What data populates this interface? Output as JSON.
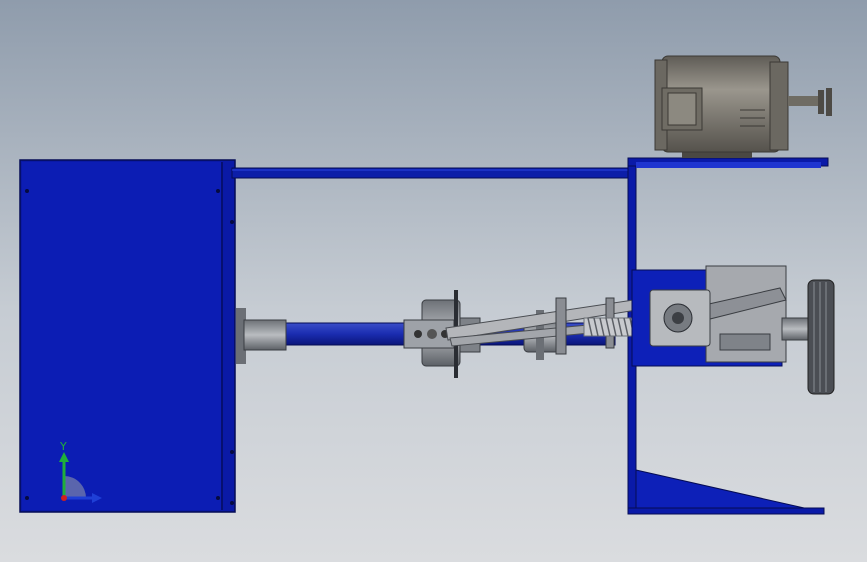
{
  "viewport": {
    "background_top": "#8f9cac",
    "background_bottom": "#dadcdf"
  },
  "colors": {
    "frame_blue": "#0a1aa8",
    "frame_blue_light": "#1f35d0",
    "metal_gray": "#8a8f96",
    "motor_body": "#7d7a73"
  },
  "triad": {
    "y_label": "Y",
    "y_color": "#1fae3a",
    "x_color": "#1f3fd6",
    "z_color": "#d01f1f"
  },
  "icons": [
    "coordinate-triad-icon"
  ]
}
